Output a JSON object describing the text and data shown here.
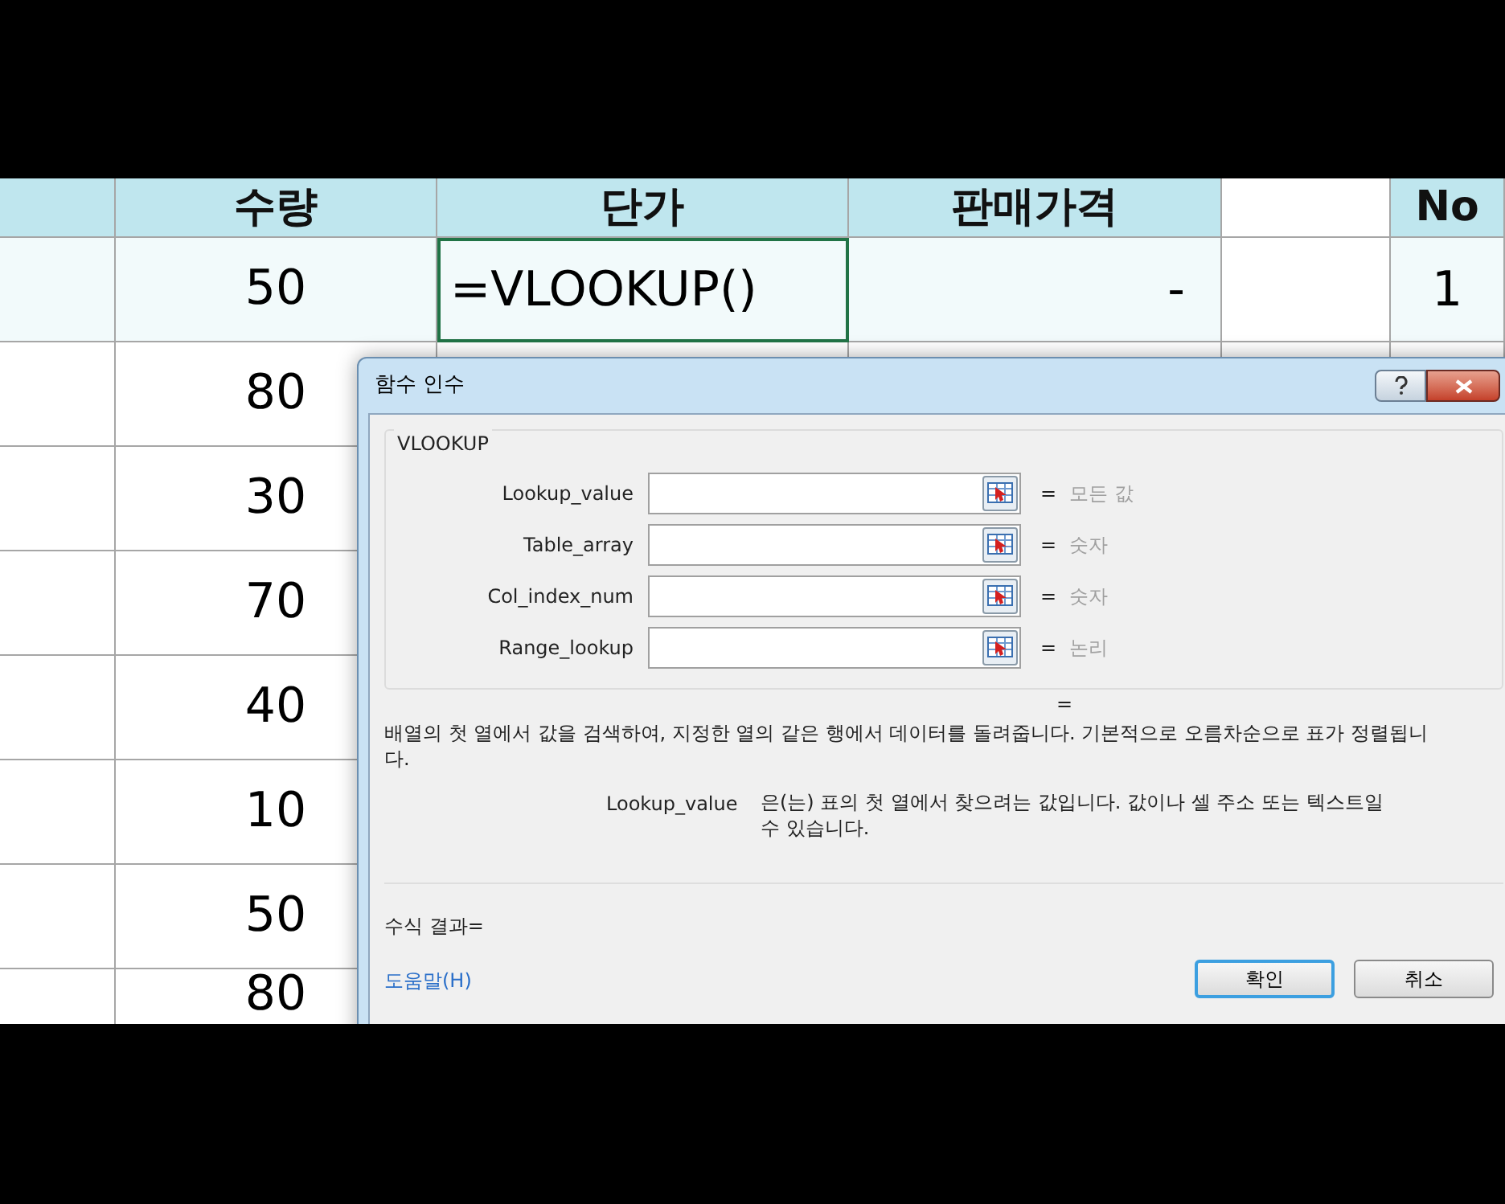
{
  "sheet": {
    "headers": [
      {
        "text": "수량"
      },
      {
        "text": "단가"
      },
      {
        "text": "판매가격"
      },
      {
        "text": "No"
      }
    ],
    "rows": [
      {
        "qty": "50",
        "price": "=VLOOKUP()",
        "price_active": true,
        "sale": "-",
        "no": "1"
      },
      {
        "qty": "80"
      },
      {
        "qty": "30"
      },
      {
        "qty": "70"
      },
      {
        "qty": "40"
      },
      {
        "qty": "10"
      },
      {
        "qty": "50"
      },
      {
        "qty": "80"
      }
    ]
  },
  "dialog": {
    "title": "함수 인수",
    "function_name": "VLOOKUP",
    "args": [
      {
        "label": "Lookup_value",
        "equals": "=",
        "hint": "모든 값"
      },
      {
        "label": "Table_array",
        "equals": "=",
        "hint": "숫자"
      },
      {
        "label": "Col_index_num",
        "equals": "=",
        "hint": "숫자"
      },
      {
        "label": "Range_lookup",
        "equals": "=",
        "hint": "논리"
      }
    ],
    "result_equals": "=",
    "description": "배열의 첫 열에서 값을 검색하여, 지정한 열의 같은 행에서 데이터를 돌려줍니다. 기본적으로 오름차순으로 표가 정렬됩니다.",
    "arg_help": {
      "name": "Lookup_value",
      "text": "은(는) 표의 첫 열에서 찾으려는 값입니다. 값이나 셀 주소 또는 텍스트일 수 있습니다."
    },
    "result_label": "수식 결과=",
    "help_link": "도움말(H)",
    "buttons": [
      {
        "label": "확인",
        "default": true
      },
      {
        "label": "취소",
        "default": false
      }
    ]
  }
}
